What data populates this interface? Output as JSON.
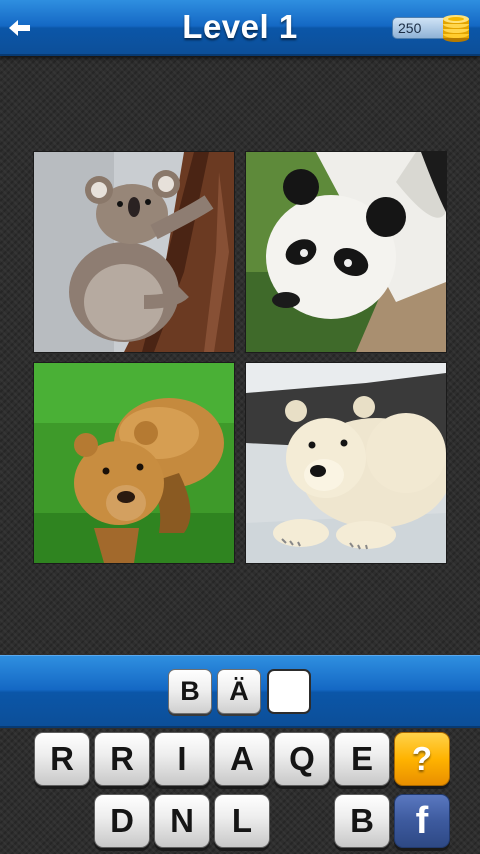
{
  "header": {
    "back_icon": "arrow-left-icon",
    "title": "Level 1",
    "coins": "250",
    "coin_icon": "gold-coin-stack-icon",
    "color_top": "#2f8fe0",
    "color_bottom": "#0c4f99"
  },
  "photos": [
    {
      "subject": "koala"
    },
    {
      "subject": "panda"
    },
    {
      "subject": "brown-bear"
    },
    {
      "subject": "polar-bear"
    }
  ],
  "answer": {
    "slots": [
      "B",
      "Ä",
      ""
    ]
  },
  "keyboard": {
    "row1": [
      "R",
      "R",
      "I",
      "A",
      "Q",
      "E"
    ],
    "row2": [
      "D",
      "N",
      "L",
      "B"
    ],
    "hint_label": "?",
    "hint_color": "#ffb300",
    "facebook_label": "f",
    "facebook_color": "#3d5a9e"
  }
}
